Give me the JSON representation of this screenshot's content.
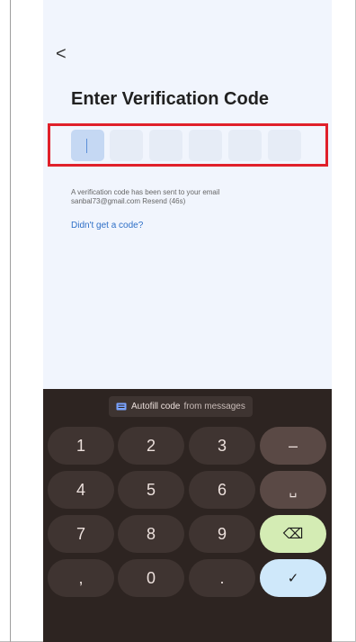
{
  "screen": {
    "back_glyph": "<",
    "title": "Enter Verification Code",
    "code_cells": 6,
    "info_line1": "A verification code has been sent to your email",
    "info_line2": "sanbal73@gmail.com Resend (46s)",
    "no_code_link": "Didn't get a code?"
  },
  "keyboard": {
    "suggestion_primary": "Autofill code",
    "suggestion_secondary": "from messages",
    "keys": {
      "k1": "1",
      "k2": "2",
      "k3": "3",
      "minus": "–",
      "k4": "4",
      "k5": "5",
      "k6": "6",
      "space": "␣",
      "k7": "7",
      "k8": "8",
      "k9": "9",
      "backspace": "⌫",
      "comma": ",",
      "k0": "0",
      "period": ".",
      "enter": "✓"
    },
    "colors": {
      "background": "#2d2421",
      "backspace": "#d4ecb4",
      "enter": "#cfe8fa"
    }
  }
}
